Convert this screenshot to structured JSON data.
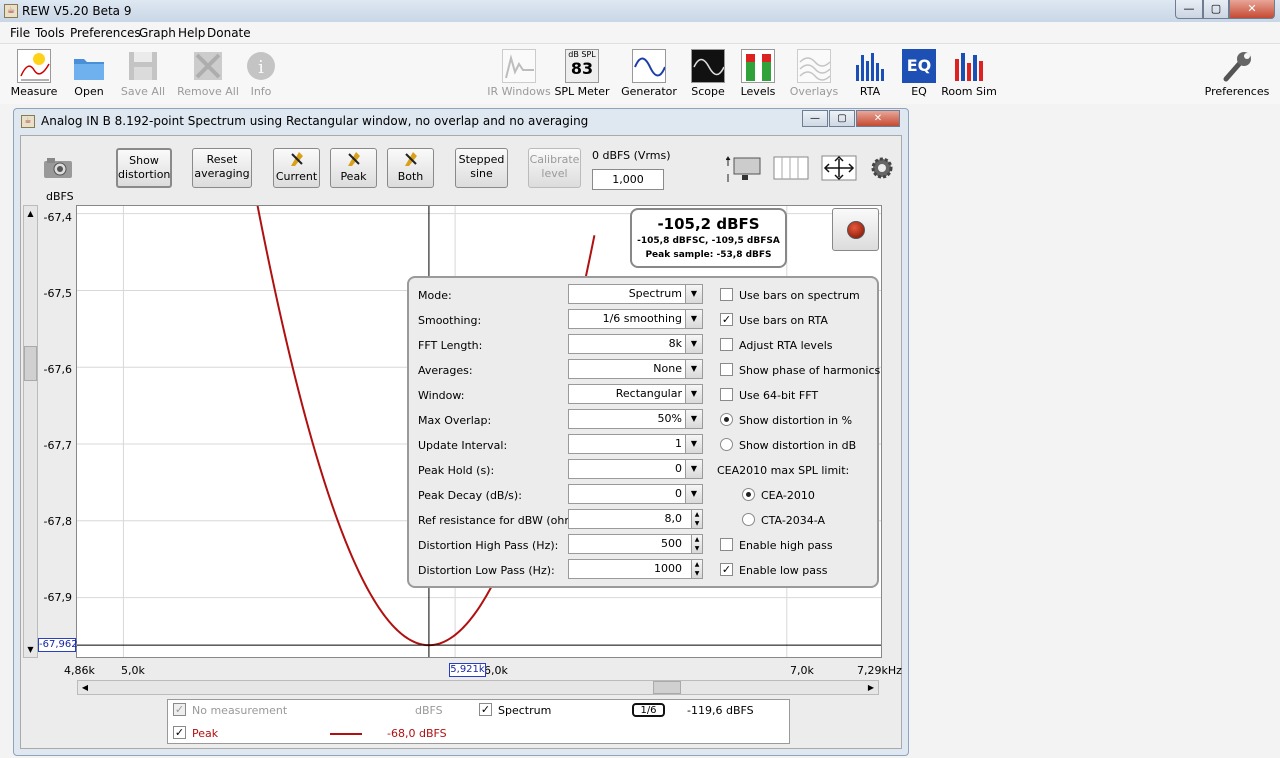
{
  "app": {
    "title": "REW V5.20 Beta 9"
  },
  "window_controls": {
    "minimize": "—",
    "maximize": "▢",
    "close": "✕"
  },
  "menu": [
    "File",
    "Tools",
    "Preferences",
    "Graph",
    "Help",
    "Donate"
  ],
  "toolbar": {
    "measure": "Measure",
    "open": "Open",
    "save_all": "Save All",
    "remove_all": "Remove All",
    "info": "Info",
    "ir_windows": "IR Windows",
    "spl_meter": "SPL Meter",
    "spl_meter_top": "dB SPL",
    "spl_meter_value": "83",
    "generator": "Generator",
    "scope": "Scope",
    "levels": "Levels",
    "overlays": "Overlays",
    "rta": "RTA",
    "eq": "EQ",
    "room_sim": "Room Sim",
    "preferences": "Preferences"
  },
  "rta_window": {
    "title": "Analog IN B 8.192-point Spectrum using Rectangular window, no overlap and no averaging",
    "buttons": {
      "show_distortion": "Show\ndistortion",
      "reset_averaging": "Reset\naveraging",
      "current": "Current",
      "peak": "Peak",
      "both": "Both",
      "stepped_sine": "Stepped\nsine",
      "calibrate_level": "Calibrate\nlevel"
    },
    "level_ref_label": "0 dBFS (Vrms)",
    "level_ref_value": "1,000",
    "y_unit": "dBFS",
    "readout": {
      "main": "-105,2 dBFS",
      "sub": "-105,8 dBFSC, -109,5 dBFSA",
      "peak": "Peak sample: -53,8 dBFS"
    },
    "cursor_y": "-67,962",
    "cursor_x": "5,921k"
  },
  "chart_data": {
    "type": "line",
    "ylabel": "dBFS",
    "xlabel": "Hz",
    "ylim": [
      -67.98,
      -67.39
    ],
    "xlim": [
      4860,
      7290
    ],
    "y_ticks": [
      "-67,4",
      "-67,5",
      "-67,6",
      "-67,7",
      "-67,8",
      "-67,9"
    ],
    "x_ticks": [
      "4,86k",
      "5,0k",
      "6,0k",
      "7,0k",
      "7,29kHz"
    ],
    "series": [
      {
        "name": "Peak",
        "color": "#b01010",
        "x": [
          5400,
          5600,
          5750,
          5850,
          5921,
          6000,
          6100,
          6250,
          6400
        ],
        "y": [
          -67.38,
          -67.72,
          -67.89,
          -67.95,
          -67.962,
          -67.95,
          -67.89,
          -67.72,
          -67.38
        ]
      }
    ]
  },
  "settings": {
    "rows": [
      {
        "label": "Mode:",
        "value": "Spectrum",
        "type": "combo"
      },
      {
        "label": "Smoothing:",
        "value": "1/6 smoothing",
        "type": "combo"
      },
      {
        "label": "FFT Length:",
        "value": "8k",
        "type": "combo"
      },
      {
        "label": "Averages:",
        "value": "None",
        "type": "combo"
      },
      {
        "label": "Window:",
        "value": "Rectangular",
        "type": "combo"
      },
      {
        "label": "Max Overlap:",
        "value": "50%",
        "type": "combo"
      },
      {
        "label": "Update Interval:",
        "value": "1",
        "type": "combo"
      },
      {
        "label": "Peak Hold (s):",
        "value": "0",
        "type": "combo"
      },
      {
        "label": "Peak Decay (dB/s):",
        "value": "0",
        "type": "combo"
      },
      {
        "label": "Ref resistance for dBW (ohm):",
        "value": "8,0",
        "type": "spin"
      },
      {
        "label": "Distortion High Pass (Hz):",
        "value": "500",
        "type": "spin"
      },
      {
        "label": "Distortion Low Pass (Hz):",
        "value": "1000",
        "type": "spin"
      }
    ],
    "options": [
      {
        "label": "Use bars on spectrum",
        "kind": "check",
        "checked": false
      },
      {
        "label": "Use bars on RTA",
        "kind": "check",
        "checked": true
      },
      {
        "label": "Adjust RTA levels",
        "kind": "check",
        "checked": false
      },
      {
        "label": "Show phase of harmonics",
        "kind": "check",
        "checked": false
      },
      {
        "label": "Use 64-bit FFT",
        "kind": "check",
        "checked": false
      },
      {
        "label": "Show distortion in %",
        "kind": "radio",
        "checked": true
      },
      {
        "label": "Show distortion in dB",
        "kind": "radio",
        "checked": false
      },
      {
        "label": "CEA2010 max SPL limit:",
        "kind": "label",
        "checked": false
      },
      {
        "label": "CEA-2010",
        "kind": "radio",
        "checked": true
      },
      {
        "label": "CTA-2034-A",
        "kind": "radio",
        "checked": false
      },
      {
        "label": "Enable high pass",
        "kind": "check",
        "checked": false
      },
      {
        "label": "Enable low pass",
        "kind": "check",
        "checked": true
      }
    ]
  },
  "legend": {
    "no_measurement": "No measurement",
    "no_measurement_unit": "dBFS",
    "spectrum": "Spectrum",
    "smoothing": "1/6",
    "spectrum_value": "-119,6 dBFS",
    "peak": "Peak",
    "peak_value": "-68,0 dBFS"
  }
}
